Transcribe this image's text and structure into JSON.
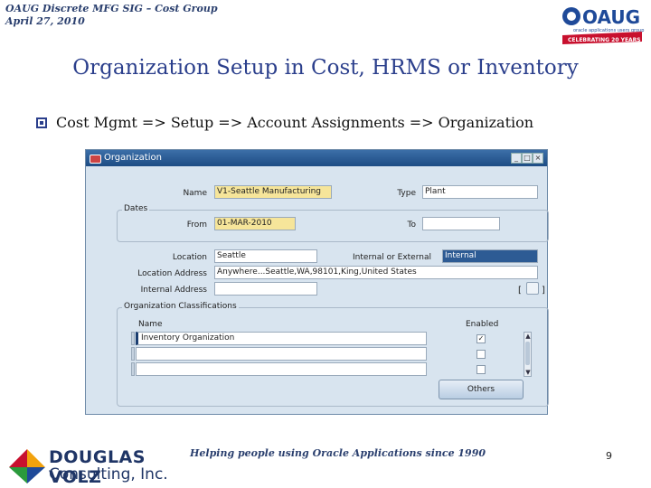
{
  "header": {
    "line1": "OAUG Discrete MFG SIG – Cost Group",
    "line2": "April 27, 2010"
  },
  "oaug_logo": {
    "text": "OAUG",
    "subtext": "oracle applications users group",
    "banner": "CELEBRATING 20 YEARS"
  },
  "slide": {
    "title": "Organization Setup in Cost, HRMS or Inventory",
    "bullet": "Cost Mgmt => Setup => Account Assignments => Organization"
  },
  "form": {
    "window_title": "Organization",
    "name_label": "Name",
    "name_value": "V1-Seattle Manufacturing",
    "type_label": "Type",
    "type_value": "Plant",
    "dates_group": "Dates",
    "from_label": "From",
    "from_value": "01-MAR-2010",
    "to_label": "To",
    "to_value": "",
    "location_label": "Location",
    "location_value": "Seattle",
    "int_ext_label": "Internal or External",
    "int_ext_value": "Internal",
    "loc_address_label": "Location Address",
    "loc_address_value": "Anywhere...Seattle,WA,98101,King,United States",
    "internal_address_label": "Internal Address",
    "internal_address_value": "",
    "classifications_group": "Organization Classifications",
    "col_name": "Name",
    "col_enabled": "Enabled",
    "rows": [
      {
        "name": "Inventory Organization",
        "enabled": true
      },
      {
        "name": "",
        "enabled": false
      },
      {
        "name": "",
        "enabled": false
      }
    ],
    "others_button": "Others"
  },
  "footer": {
    "company_line1": "DOUGLAS VOLZ",
    "company_line2": "Consulting, Inc.",
    "tagline": "Helping people using Oracle Applications since 1990",
    "page_number": "9"
  },
  "colors": {
    "title_blue": "#2b3f8c",
    "required_field": "#f6e59a",
    "form_background": "#d8e4ef",
    "titlebar": "#1d4c84"
  }
}
